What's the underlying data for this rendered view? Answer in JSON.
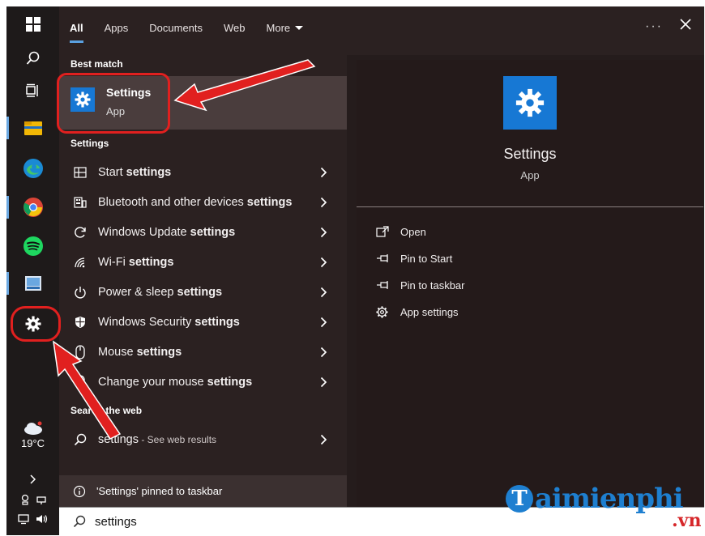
{
  "tabs": [
    {
      "label": "All",
      "active": true
    },
    {
      "label": "Apps"
    },
    {
      "label": "Documents"
    },
    {
      "label": "Web"
    },
    {
      "label": "More"
    }
  ],
  "window": {
    "more_options": "···"
  },
  "best_match": {
    "section_label": "Best match",
    "title": "Settings",
    "subtitle": "App",
    "icon": "gear-icon"
  },
  "settings_section": {
    "label": "Settings",
    "items": [
      {
        "prefix": "Start ",
        "bold": "settings",
        "icon": "start-layout-icon"
      },
      {
        "prefix": "Bluetooth and other devices ",
        "bold": "settings",
        "icon": "keyboard-devices-icon"
      },
      {
        "prefix": "Windows Update ",
        "bold": "settings",
        "icon": "refresh-icon"
      },
      {
        "prefix": "Wi-Fi ",
        "bold": "settings",
        "icon": "wifi-icon"
      },
      {
        "prefix": "Power & sleep ",
        "bold": "settings",
        "icon": "power-icon"
      },
      {
        "prefix": "Windows Security ",
        "bold": "settings",
        "icon": "shield-icon"
      },
      {
        "prefix": "Mouse ",
        "bold": "settings",
        "icon": "mouse-icon"
      },
      {
        "prefix": "Change your mouse ",
        "bold": "settings",
        "icon": "mouse-icon"
      }
    ]
  },
  "web_section": {
    "label": "Search the web",
    "query": "settings",
    "hint": " - See web results"
  },
  "notice": {
    "text": "'Settings' pinned to taskbar"
  },
  "search": {
    "value": "settings"
  },
  "detail": {
    "title": "Settings",
    "subtitle": "App",
    "actions": [
      {
        "label": "Open",
        "icon": "open-icon"
      },
      {
        "label": "Pin to Start",
        "icon": "pin-icon"
      },
      {
        "label": "Pin to taskbar",
        "icon": "pin-icon"
      },
      {
        "label": "App settings",
        "icon": "gear-icon"
      }
    ]
  },
  "taskbar": {
    "weather_temp": "19°C"
  },
  "watermark": {
    "brand": "aimienphi",
    "badge": "T",
    "tld": ".vn"
  },
  "colors": {
    "accent": "#1778d4",
    "callout": "#e1201f"
  }
}
